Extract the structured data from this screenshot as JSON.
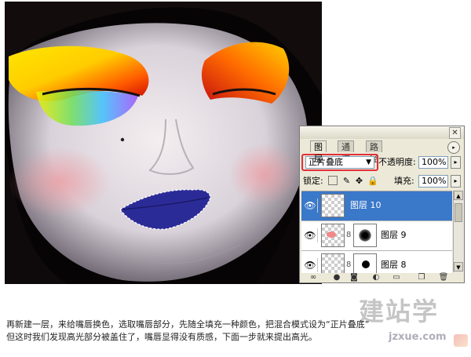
{
  "panel": {
    "close_glyph": "✕",
    "menu_glyph": "▸",
    "tabs": [
      {
        "label": "图层"
      },
      {
        "label": "通道"
      },
      {
        "label": "路径"
      }
    ],
    "blend_mode": "正片叠底",
    "blend_arrow": "▼",
    "opacity_label": "不透明度:",
    "opacity_value": "100%",
    "lock_label": "锁定:",
    "fill_label": "填充:",
    "fill_value": "100%",
    "stepper_glyph": "▸",
    "eye_glyph": "👁",
    "chain_glyph": "8",
    "layers": [
      {
        "name": "图层 10"
      },
      {
        "name": "图层 9"
      },
      {
        "name": "图层 8"
      }
    ],
    "scroll_up": "▲",
    "scroll_down": "▼"
  },
  "caption": {
    "line1": "再新建一层，来给嘴唇换色，选取嘴唇部分，先随全填充一种颜色，把混合模式设为“正片叠底”",
    "line2": "但这时我们发现高光部分被盖住了，嘴唇显得没有质感，下面一步就来提出高光。"
  },
  "watermark": {
    "text": "建站学",
    "url": "jzxue.com"
  },
  "colors": {
    "selection_blue": "#3a78c9",
    "highlight_red": "#e2303a",
    "lip_blue": "#2a2a9a"
  },
  "icons": {
    "lock_transparency": "lock-transparency-icon",
    "lock_brush": "brush-icon",
    "lock_move": "move-icon",
    "lock_all": "lock-icon"
  }
}
